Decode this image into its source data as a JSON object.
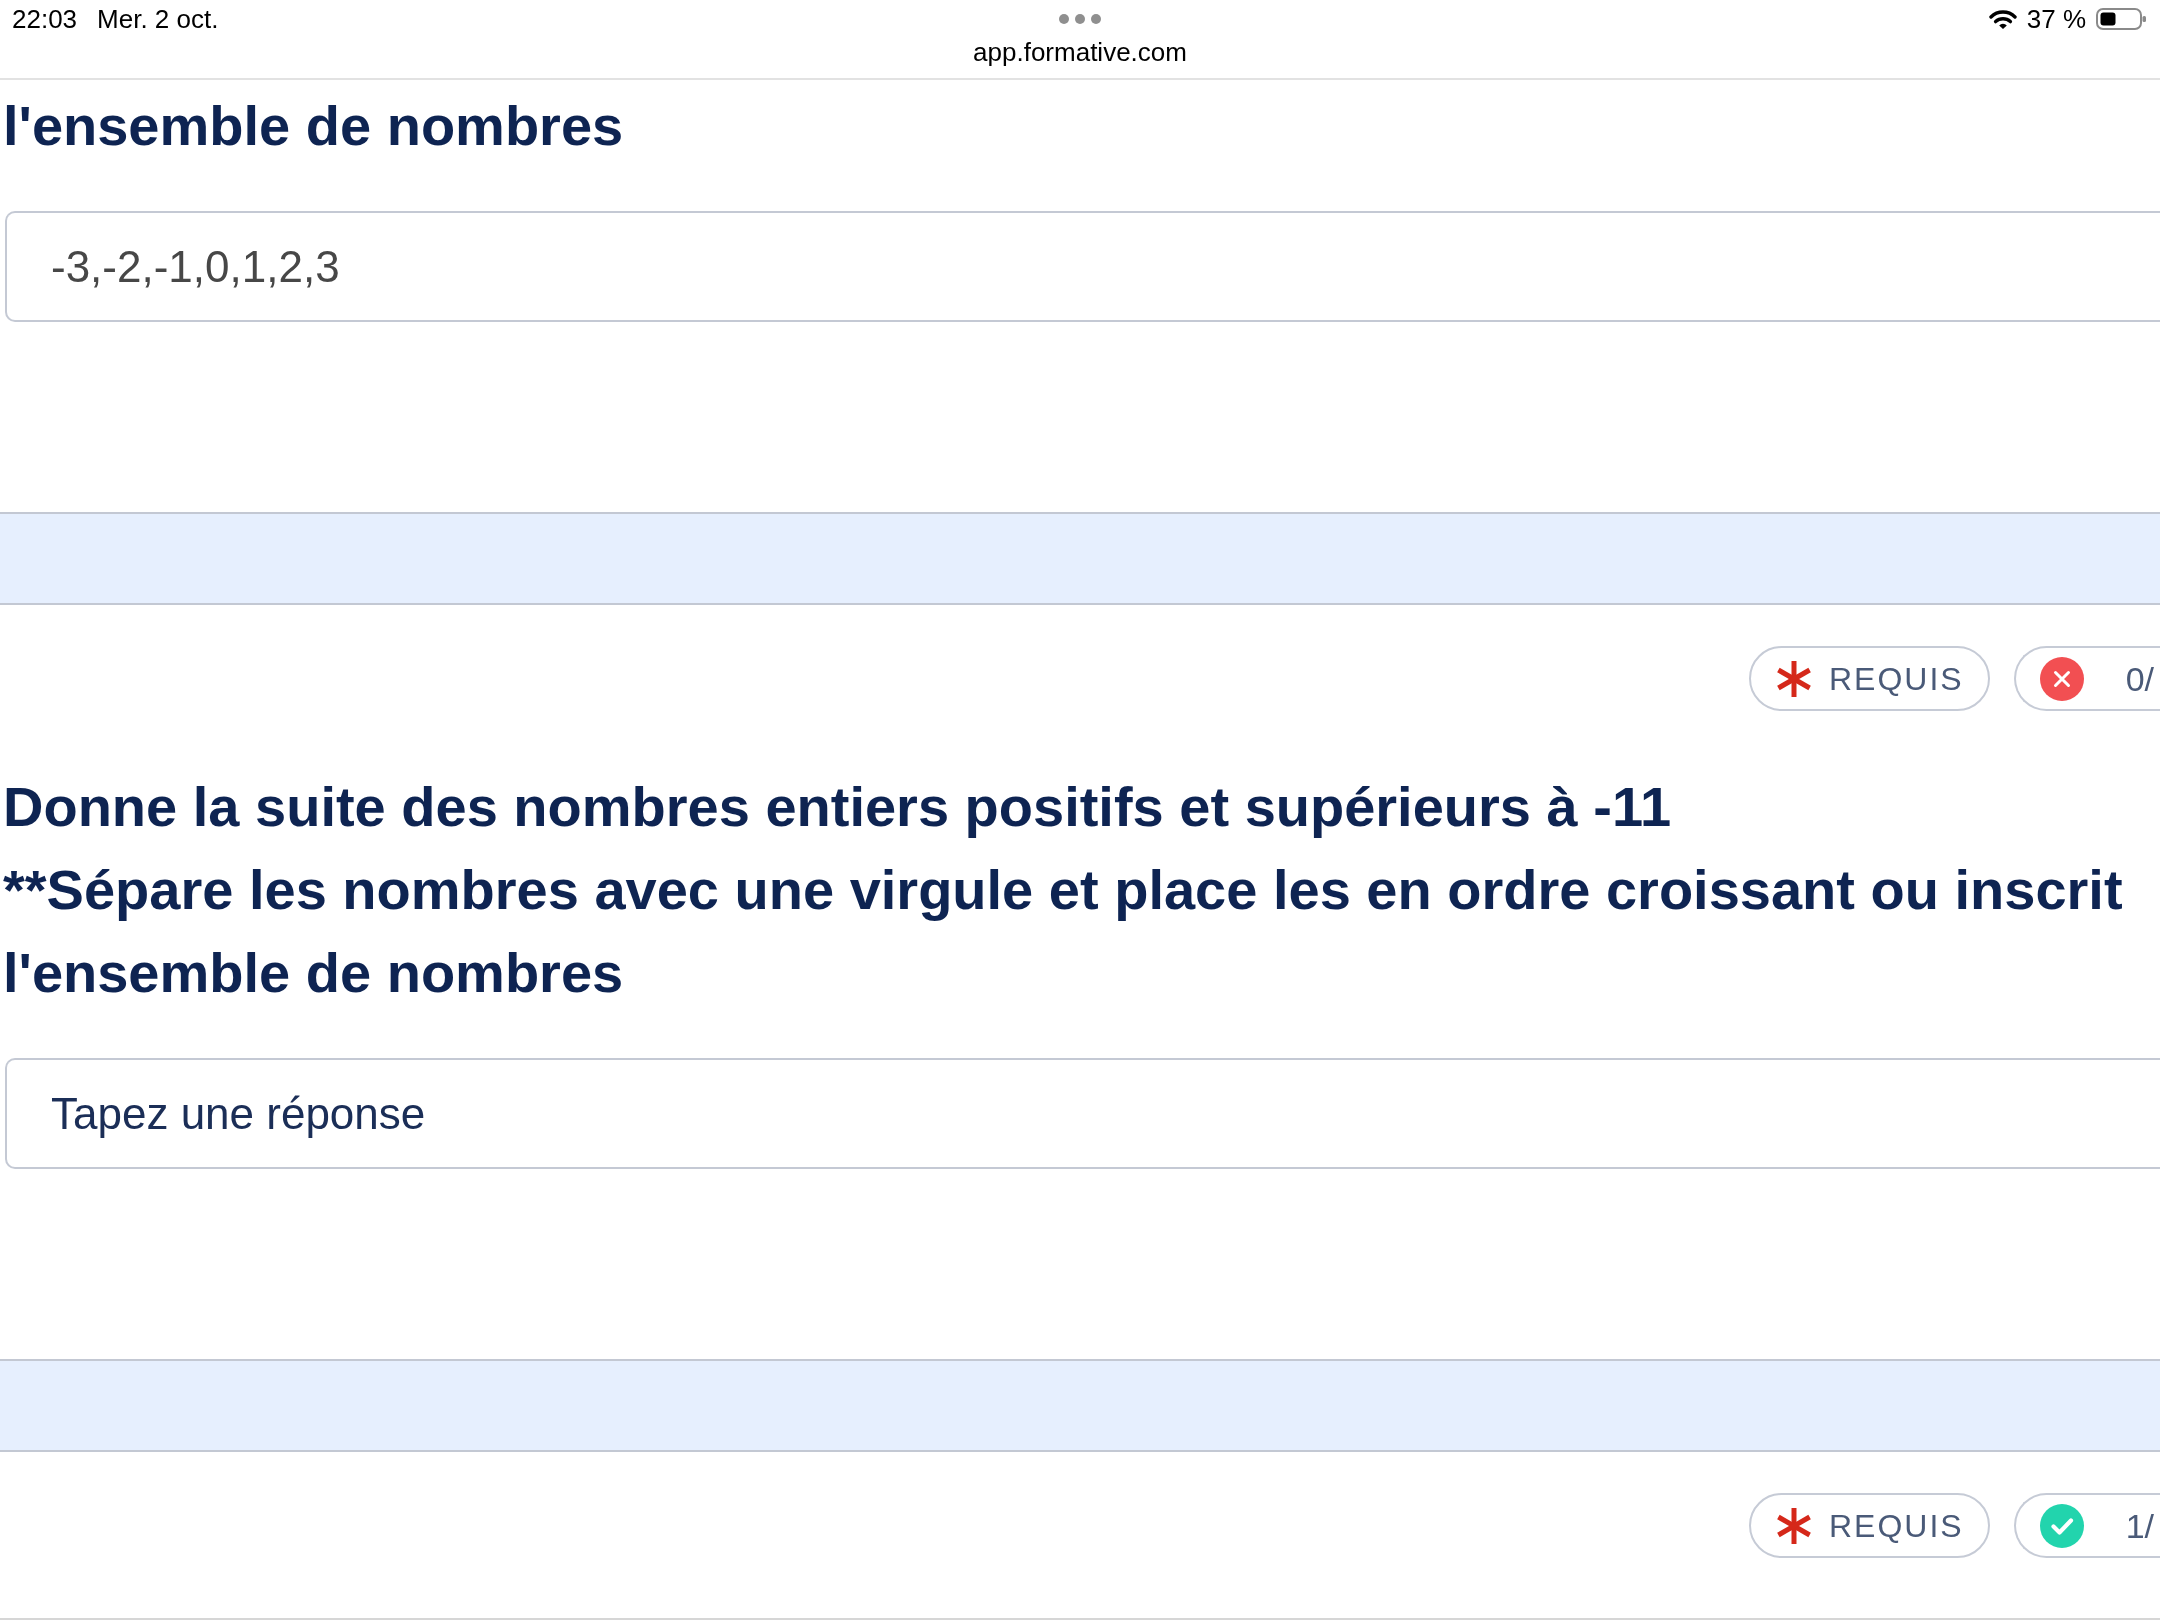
{
  "status_bar": {
    "time": "22:03",
    "date": "Mer. 2 oct.",
    "url": "app.formative.com",
    "battery": "37 %"
  },
  "questions": [
    {
      "prompt_lines": [
        "l'ensemble de nombres"
      ],
      "answer": {
        "value": "-3,-2,-1,0,1,2,3"
      }
    },
    {
      "badges": [
        {
          "kind": "required",
          "label": "REQUIS"
        },
        {
          "kind": "score",
          "correct": false,
          "label": "0/"
        }
      ],
      "prompt_lines": [
        "Donne la suite des nombres entiers positifs et supérieurs à -11",
        "**Sépare les nombres avec une virgule et place les en ordre croissant ou inscrit",
        "l'ensemble de nombres"
      ],
      "answer": {
        "placeholder": "Tapez une réponse"
      }
    },
    {
      "badges": [
        {
          "kind": "required",
          "label": "REQUIS"
        },
        {
          "kind": "score",
          "correct": true,
          "label": "1/"
        }
      ]
    }
  ]
}
